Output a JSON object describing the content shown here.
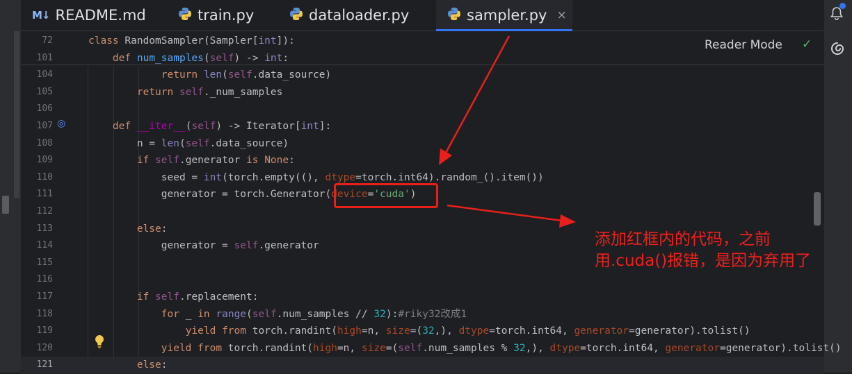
{
  "tabs": [
    {
      "label": "README.md",
      "icon": "markdown-icon",
      "icon_text": "M↓",
      "active": false
    },
    {
      "label": "train.py",
      "icon": "python-icon",
      "active": false
    },
    {
      "label": "dataloader.py",
      "icon": "python-icon",
      "active": false
    },
    {
      "label": "sampler.py",
      "icon": "python-icon",
      "active": true,
      "close": "×"
    }
  ],
  "tabs_menu": "⋮",
  "reader_mode": {
    "label": "Reader Mode",
    "status_icon": "check-icon",
    "status_glyph": "✓"
  },
  "gutter": {
    "override_icon": "overrides-icon",
    "override_glyph": "◎",
    "bulb_icon": "lightbulb-icon"
  },
  "code_lines": [
    {
      "num": "72",
      "sticky": true,
      "html": "<span class=\"kw\">class</span> RandomSampler(Sampler[<span class=\"bi\">int</span>]):"
    },
    {
      "num": "101",
      "sticky": true,
      "html": "    <span class=\"kw\">def</span> <span class=\"fn\">num_samples</span>(<span class=\"self\">self</span>) -&gt; <span class=\"bi\">int</span>:"
    },
    {
      "num": "104",
      "html": "            <span class=\"kw\">return</span> <span class=\"bi\">len</span>(<span class=\"self\">self</span>.data_source)"
    },
    {
      "num": "105",
      "html": "        <span class=\"kw\">return</span> <span class=\"self\">self</span>._num_samples"
    },
    {
      "num": "106",
      "html": ""
    },
    {
      "num": "107",
      "html": "    <span class=\"kw\">def</span> <span class=\"dunder\">__iter__</span>(<span class=\"self\">self</span>) -&gt; Iterator[<span class=\"bi\">int</span>]:"
    },
    {
      "num": "108",
      "html": "        n = <span class=\"bi\">len</span>(<span class=\"self\">self</span>.data_source)"
    },
    {
      "num": "109",
      "html": "        <span class=\"kw\">if</span> <span class=\"self\">self</span>.generator <span class=\"kw\">is</span> <span class=\"kw\">None</span>:"
    },
    {
      "num": "110",
      "html": "            seed = <span class=\"bi\">int</span>(torch.empty((), <span class=\"param\">dtype</span>=torch.int64).random_().item())"
    },
    {
      "num": "111",
      "html": "            generator = torch.Generator(<span class=\"param\">device</span>=<span class=\"str\">'cuda'</span>)"
    },
    {
      "num": "112",
      "html": ""
    },
    {
      "num": "113",
      "html": "        <span class=\"kw\">else</span>:"
    },
    {
      "num": "114",
      "html": "            generator = <span class=\"self\">self</span>.generator"
    },
    {
      "num": "115",
      "html": ""
    },
    {
      "num": "116",
      "html": ""
    },
    {
      "num": "117",
      "html": "        <span class=\"kw\">if</span> <span class=\"self\">self</span>.replacement:"
    },
    {
      "num": "118",
      "html": "            <span class=\"kw\">for</span> _ <span class=\"kw\">in</span> <span class=\"bi\">range</span>(<span class=\"self\">self</span>.num_samples // <span class=\"num\">32</span>):<span class=\"cmt\">#riky32改成1</span>"
    },
    {
      "num": "119",
      "html": "                <span class=\"kw\">yield from</span> torch.randint(<span class=\"param\">high</span>=n, <span class=\"param\">size</span>=(<span class=\"num\">32</span>,), <span class=\"param\">dtype</span>=torch.int64, <span class=\"param\">generator</span>=generator).tolist()"
    },
    {
      "num": "120",
      "html": "            <span class=\"kw\">yield from</span> torch.randint(<span class=\"param\">high</span>=n, <span class=\"param\">size</span>=(<span class=\"self\">self</span>.num_samples % <span class=\"num\">32</span>,), <span class=\"param\">dtype</span>=torch.int64, <span class=\"param\">generator</span>=generator).tolist()"
    },
    {
      "num": "121",
      "current": true,
      "html": "        <span class=\"kw\">else</span>:"
    }
  ],
  "annotation": {
    "text": "添加红框内的代码，之前用.cuda()报错，是因为弃用了",
    "color": "#f0201c"
  },
  "colors": {
    "accent": "#3574f0",
    "annotation_red": "#e8201b"
  }
}
